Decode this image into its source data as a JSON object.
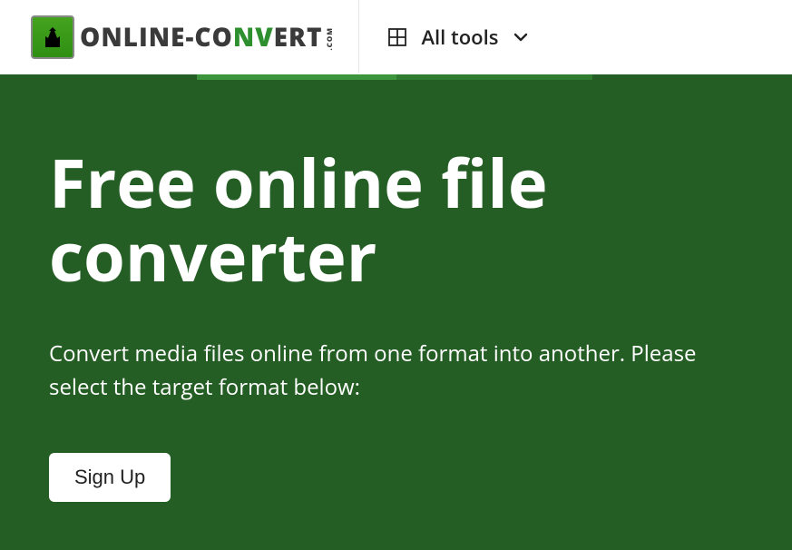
{
  "header": {
    "brand": {
      "online": "ONLINE",
      "dash": "-",
      "co": "CO",
      "n": "N",
      "v": "V",
      "ert": "ERT",
      "com": ".COM"
    },
    "all_tools_label": "All tools"
  },
  "hero": {
    "headline": "Free online file converter",
    "subtext": "Convert media files online from one format into another. Please select the target format below:",
    "signup_label": "Sign Up"
  }
}
